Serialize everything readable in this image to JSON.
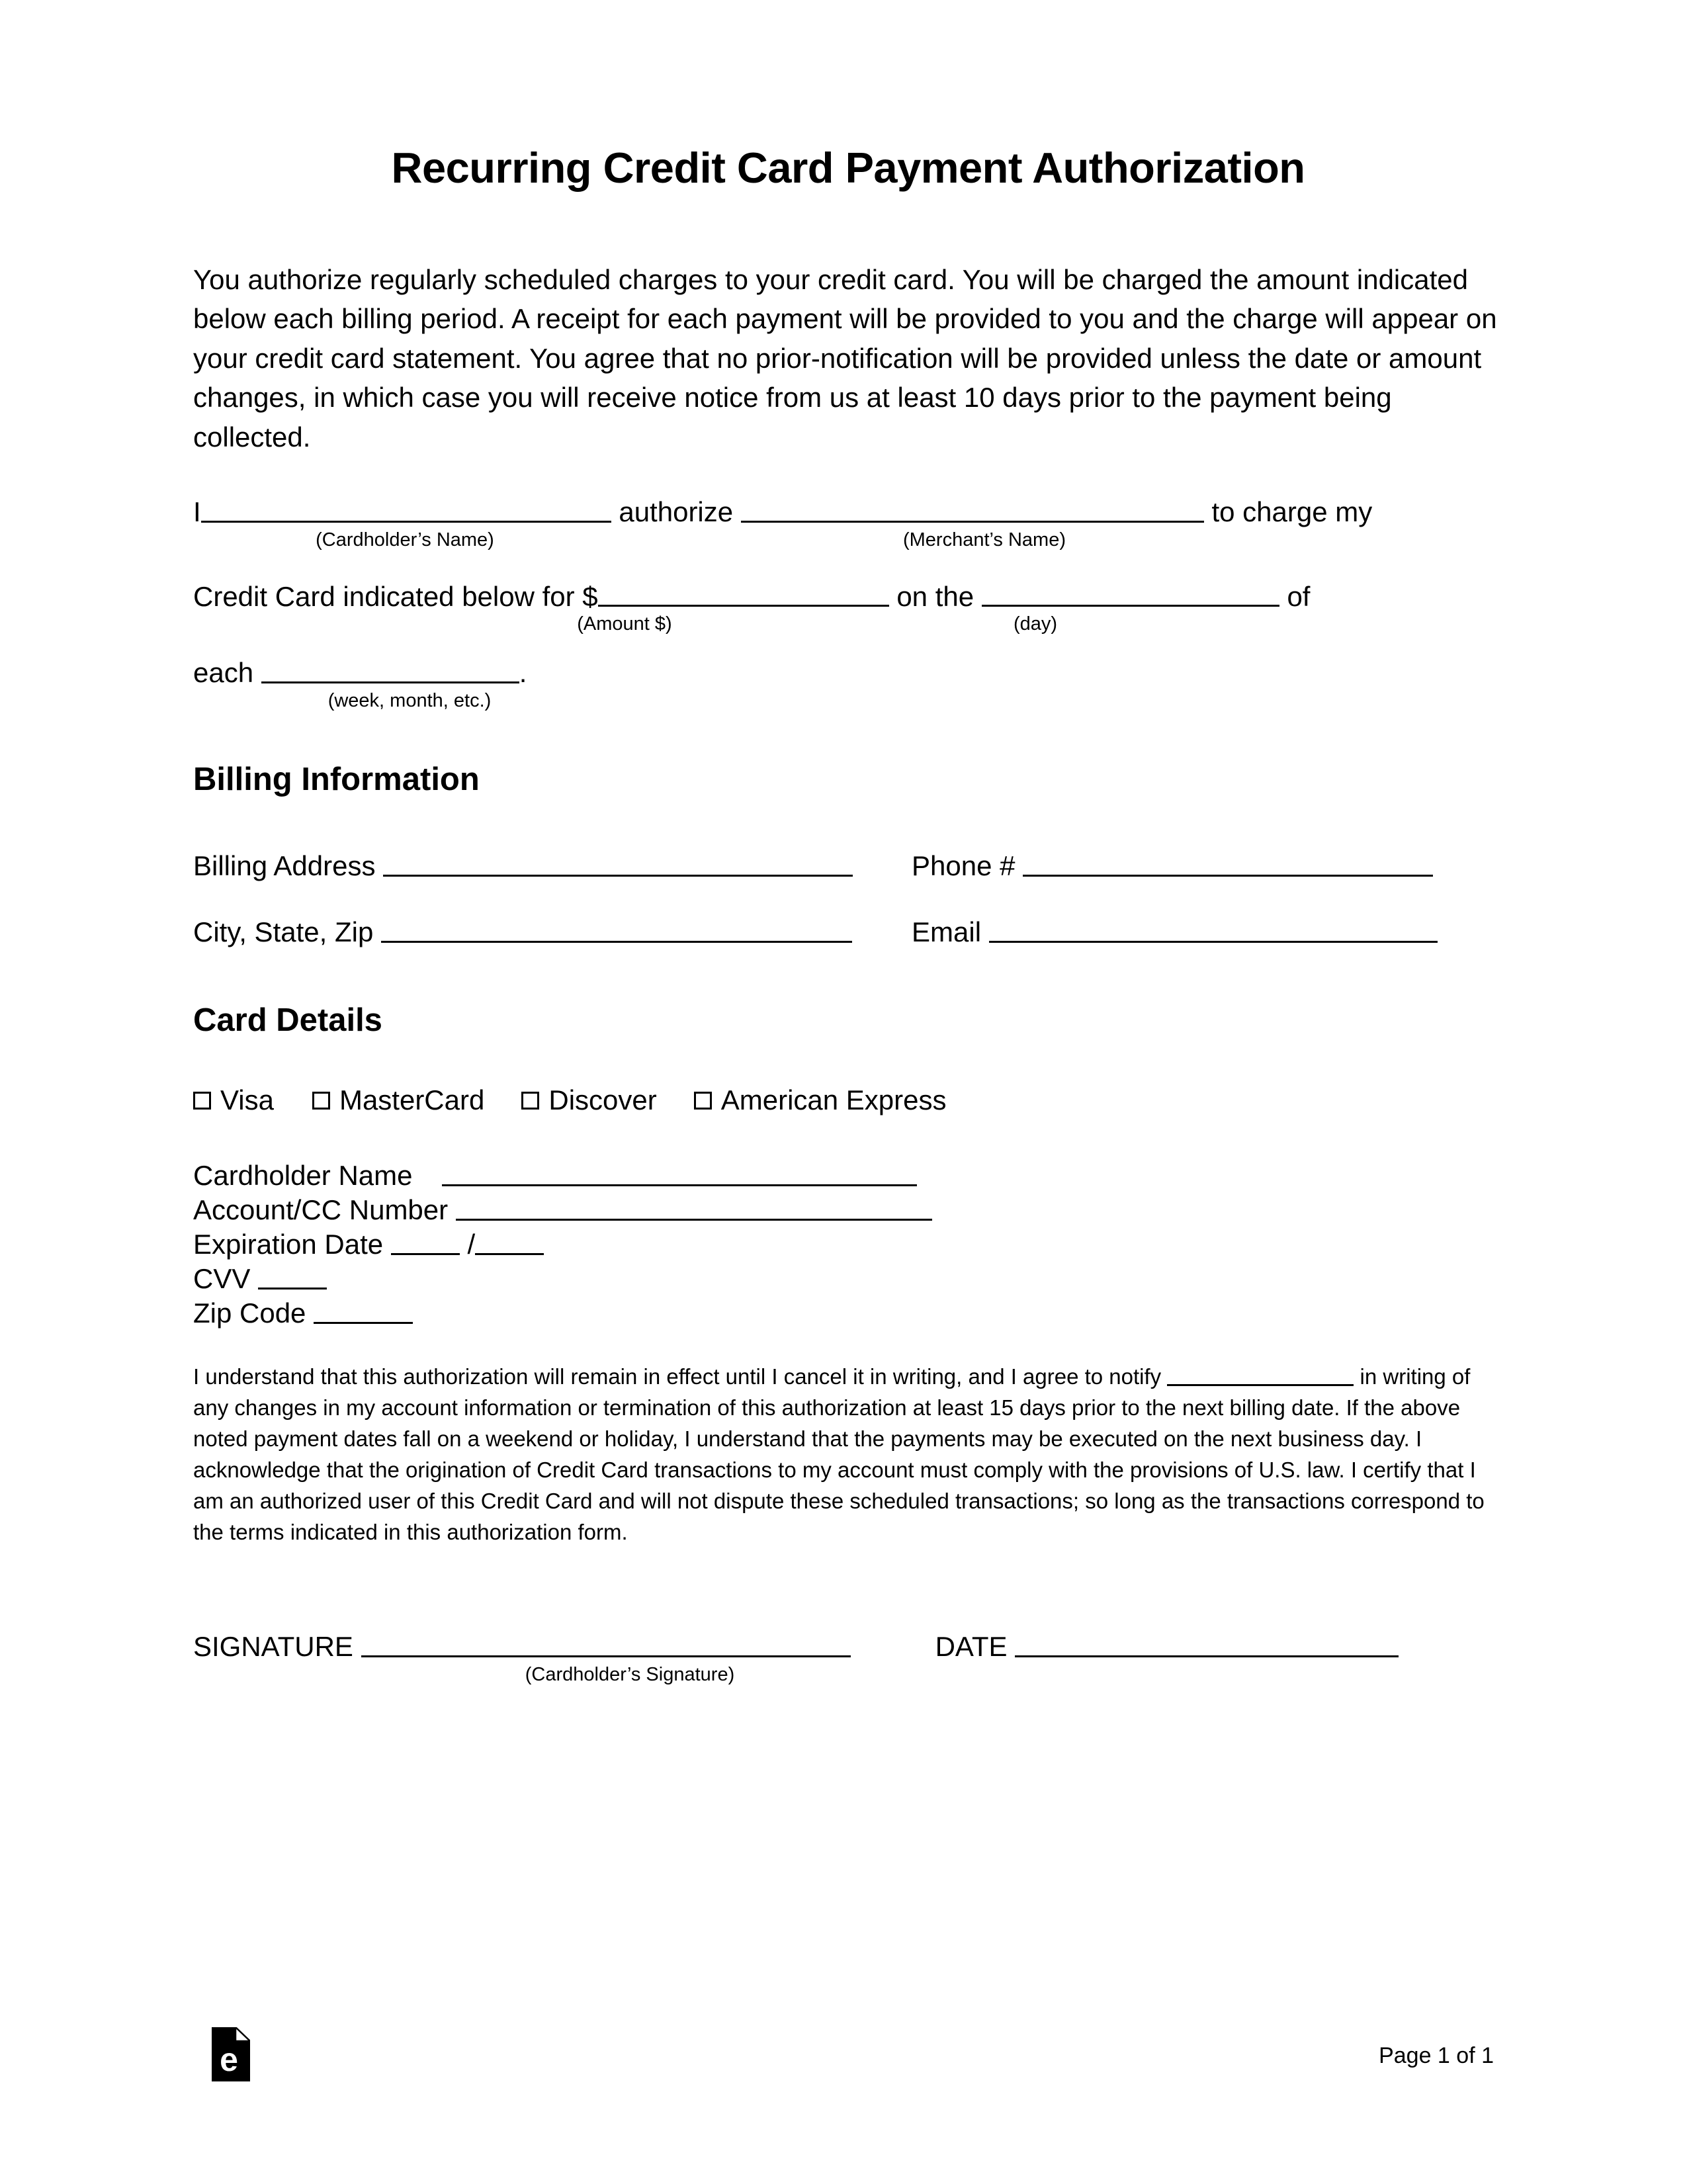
{
  "document": {
    "title": "Recurring Credit Card Payment Authorization",
    "intro_paragraph": "You authorize regularly scheduled charges to your credit card. You will be charged the amount indicated below each billing period. A receipt for each payment will be provided to you and the charge will appear on your credit card statement. You agree that no prior-notification will be provided unless the date or amount changes, in which case you will receive notice from us at least 10 days prior to the payment being collected."
  },
  "authorization": {
    "line1_prefix": "I",
    "line1_middle": "authorize",
    "line1_suffix": "to charge my",
    "caption_cardholder": "(Cardholder’s Name)",
    "caption_merchant": "(Merchant’s Name)",
    "line2_prefix": "Credit Card indicated below for $",
    "line2_middle": "on the",
    "line2_suffix": "of",
    "caption_amount": "(Amount $)",
    "caption_day": "(day)",
    "line3_prefix": "each",
    "line3_suffix": ".",
    "caption_period": "(week, month, etc.)"
  },
  "billing": {
    "heading": "Billing Information",
    "address_label": "Billing Address",
    "phone_label": "Phone #",
    "city_label": "City, State, Zip",
    "email_label": "Email"
  },
  "card": {
    "heading": "Card Details",
    "types": [
      {
        "label": "Visa",
        "checked": false
      },
      {
        "label": "MasterCard",
        "checked": false
      },
      {
        "label": "Discover",
        "checked": false
      },
      {
        "label": "American Express",
        "checked": false
      }
    ],
    "cardholder_name_label": "Cardholder Name",
    "account_number_label": "Account/CC Number",
    "expiration_label": "Expiration Date",
    "expiration_separator": "/",
    "cvv_label": "CVV",
    "zip_label": "Zip Code"
  },
  "terms": {
    "part1": "I understand that this authorization will remain in effect until I cancel it in writing, and I agree to notify",
    "part2": "in writing of any changes in my account information or termination of this authorization at least 15 days prior to the next billing date. If the above noted payment dates fall on a weekend or holiday, I understand that the payments may be executed on the next business day. I acknowledge that the origination of Credit Card transactions to my account must comply with the provisions of U.S. law. I certify that I am an authorized user of this Credit Card and will not dispute these scheduled transactions; so long as the transactions correspond to the terms indicated in this authorization form."
  },
  "signature": {
    "signature_label": "SIGNATURE",
    "date_label": "DATE",
    "caption_signature": "(Cardholder’s Signature)"
  },
  "footer": {
    "logo_letter": "e",
    "page_number": "Page 1 of 1"
  }
}
